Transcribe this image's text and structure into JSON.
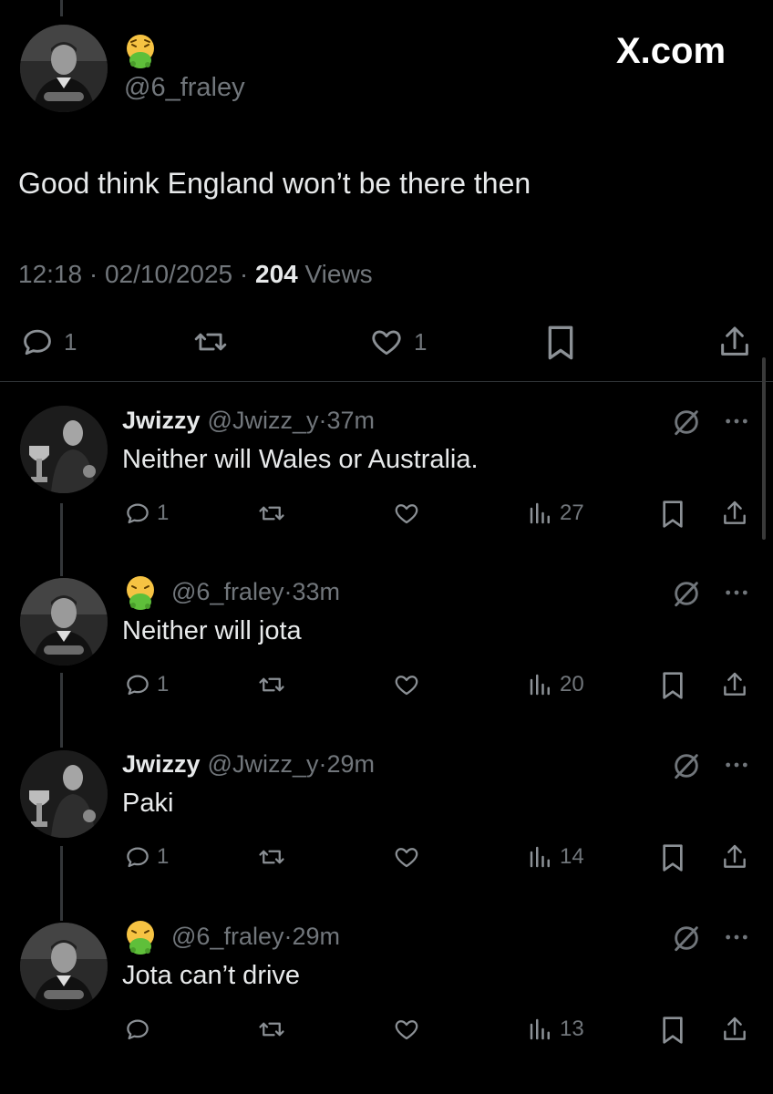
{
  "brand": "X.com",
  "main_tweet": {
    "handle": "@6_fraley",
    "text": "Good think England won’t be there then",
    "time": "12:18",
    "date": "02/10/2025",
    "separator": "·",
    "views_count": "204",
    "views_label": "Views",
    "replies": "1",
    "likes": "1"
  },
  "replies": [
    {
      "name": "Jwizzy",
      "handle": "@Jwizz_y",
      "age": "37m",
      "text": "Neither will Wales or Australia.",
      "replies": "1",
      "views": "27"
    },
    {
      "name": "",
      "handle": "@6_fraley",
      "age": "33m",
      "text": "Neither will jota",
      "replies": "1",
      "views": "20"
    },
    {
      "name": "Jwizzy",
      "handle": "@Jwizz_y",
      "age": "29m",
      "text": "Paki",
      "replies": "1",
      "views": "14"
    },
    {
      "name": "",
      "handle": "@6_fraley",
      "age": "29m",
      "text": "Jota can’t drive",
      "replies": "",
      "views": "13"
    }
  ],
  "separator": "·",
  "icons": [
    "reply-icon",
    "retweet-icon",
    "like-icon",
    "bookmark-icon",
    "share-icon",
    "views-icon",
    "grok-icon",
    "more-icon",
    "nauseated-face-emoji"
  ]
}
